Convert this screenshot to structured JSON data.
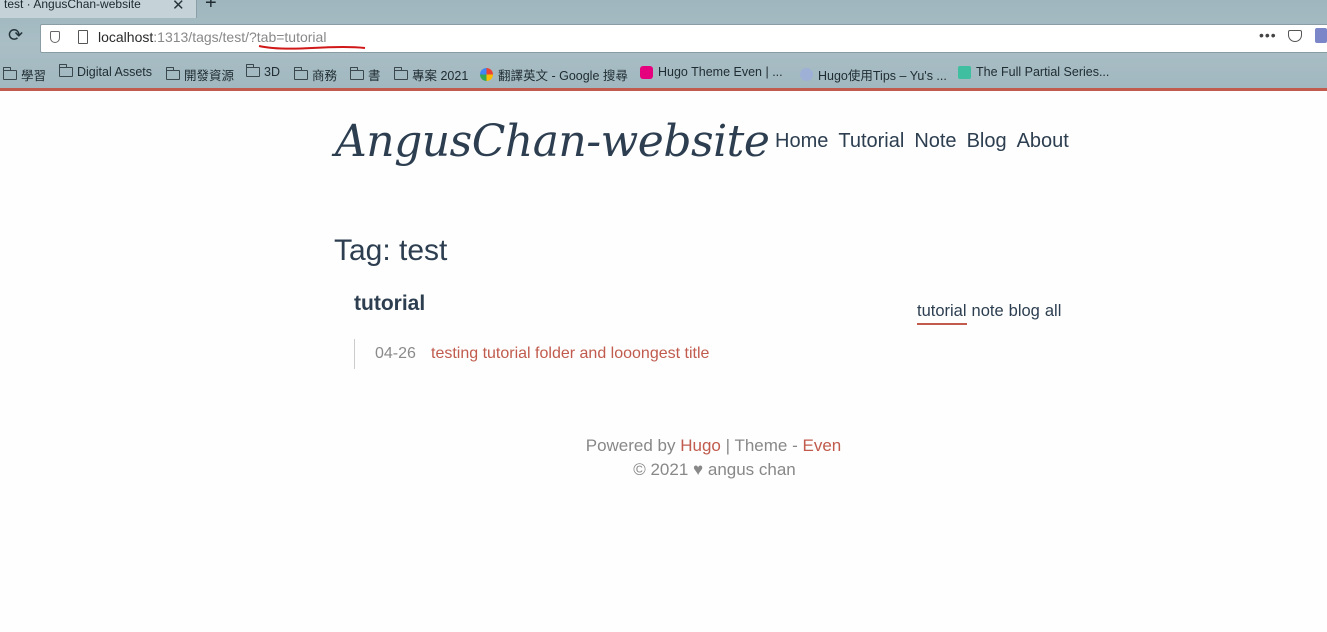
{
  "browser": {
    "tab_title": "test · AngusChan-website",
    "tab_close": "✕",
    "new_tab": "+",
    "url_host": "localhost",
    "url_rest": ":1313/tags/test/?tab=tutorial",
    "more": "•••"
  },
  "bookmarks": [
    {
      "label": "學習",
      "icon": "folder-icon"
    },
    {
      "label": "Digital Assets",
      "icon": "folder-icon"
    },
    {
      "label": "開發資源",
      "icon": "folder-icon"
    },
    {
      "label": "3D",
      "icon": "folder-icon"
    },
    {
      "label": "商務",
      "icon": "folder-icon"
    },
    {
      "label": "書",
      "icon": "folder-icon"
    },
    {
      "label": "專案 2021",
      "icon": "folder-icon"
    },
    {
      "label": "翻譯英文 - Google 搜尋",
      "icon": "google-icon"
    },
    {
      "label": "Hugo Theme Even | ...",
      "icon": "hugo-icon"
    },
    {
      "label": "Hugo使用Tips – Yu's ...",
      "icon": "site-icon"
    },
    {
      "label": "The Full Partial Series...",
      "icon": "re-icon"
    }
  ],
  "site": {
    "title": "AngusChan-website",
    "nav": [
      "Home",
      "Tutorial",
      "Note",
      "Blog",
      "About"
    ]
  },
  "page": {
    "tag_title": "Tag: test",
    "section_title": "tutorial",
    "tabs": [
      "tutorial",
      "note",
      "blog",
      "all"
    ],
    "active_tab": "tutorial",
    "posts": [
      {
        "date": "04-26",
        "title": "testing tutorial folder and looongest title"
      }
    ]
  },
  "footer": {
    "powered_by": "Powered by",
    "hugo": "Hugo",
    "sep": "|",
    "theme": "Theme -",
    "even": "Even",
    "copyright": "© 2021",
    "heart": "♥",
    "author": "angus chan"
  },
  "colors": {
    "accent": "#c05b4d",
    "text": "#2c3e50",
    "muted": "#888888"
  }
}
